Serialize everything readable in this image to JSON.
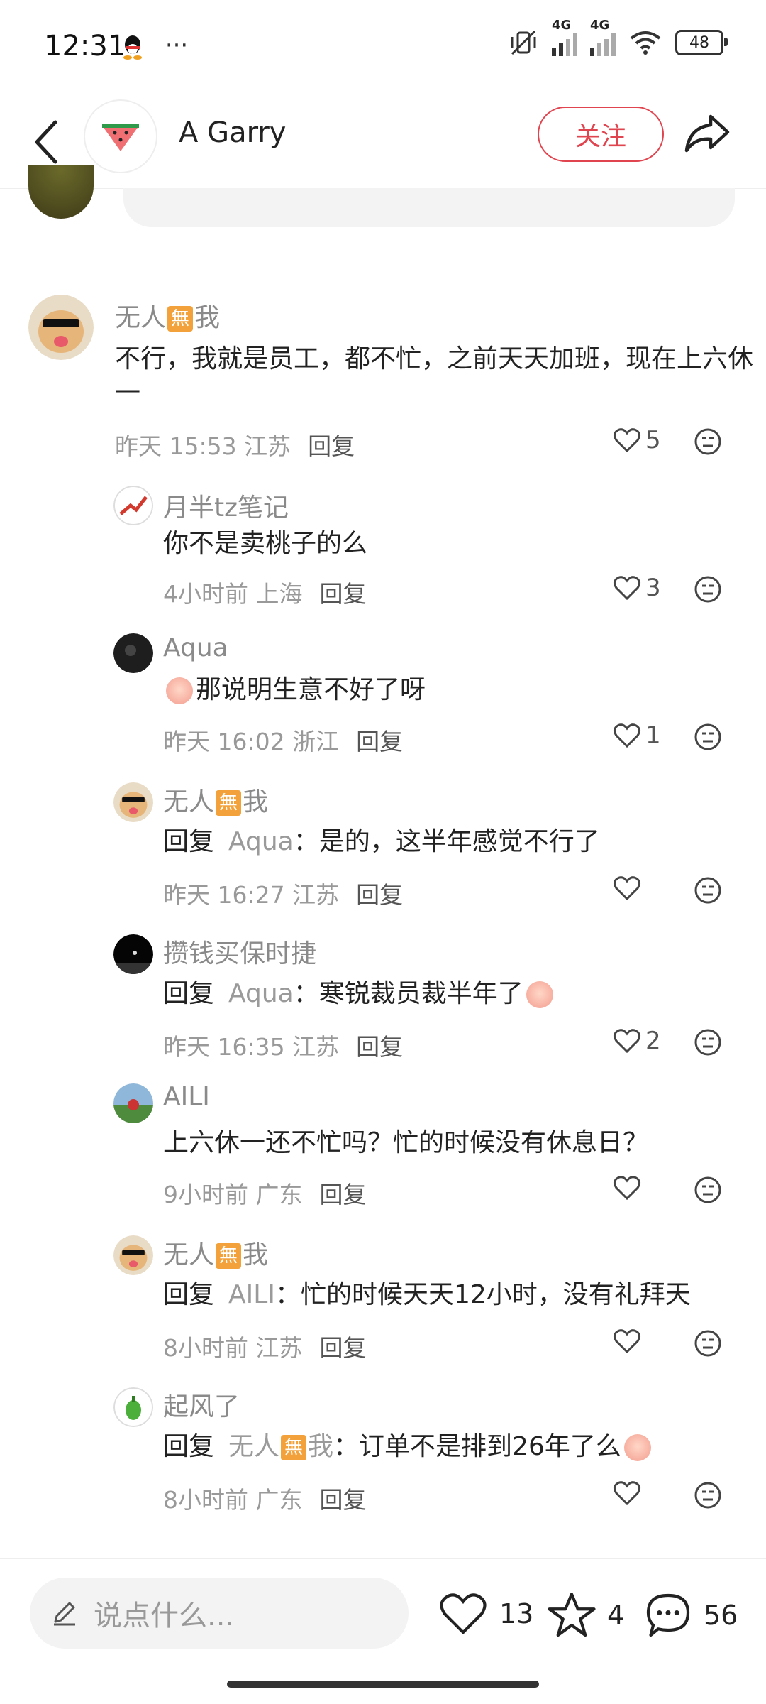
{
  "status_bar": {
    "time": "12:31",
    "more": "···",
    "net1": "4G",
    "net2": "4G",
    "battery": "48"
  },
  "header": {
    "title": "A Garry",
    "follow_label": "关注"
  },
  "comments": [
    {
      "name_a": "无人",
      "badge": "無",
      "name_b": "我",
      "text": "不行，我就是员工，都不忙，之前天天加班，现在上六休一",
      "meta": "昨天 15:53 江苏",
      "reply_label": "回复",
      "likes": "5"
    },
    {
      "name": "月半tz笔记",
      "text": "你不是卖桃子的么",
      "meta": "4小时前 上海",
      "reply_label": "回复",
      "likes": "3"
    },
    {
      "name": "Aqua",
      "text": "那说明生意不好了呀",
      "meta": "昨天 16:02 浙江",
      "reply_label": "回复",
      "likes": "1"
    },
    {
      "name_a": "无人",
      "badge": "無",
      "name_b": "我",
      "prefix": "回复",
      "target": "Aqua",
      "text": "：是的，这半年感觉不行了",
      "meta": "昨天 16:27 江苏",
      "reply_label": "回复",
      "likes": ""
    },
    {
      "name": "攒钱买保时捷",
      "prefix": "回复",
      "target": "Aqua",
      "text": "：寒锐裁员裁半年了",
      "meta": "昨天 16:35 江苏",
      "reply_label": "回复",
      "likes": "2"
    },
    {
      "name": "AILI",
      "text": "上六休一还不忙吗？忙的时候没有休息日？",
      "meta": "9小时前 广东",
      "reply_label": "回复",
      "likes": ""
    },
    {
      "name_a": "无人",
      "badge": "無",
      "name_b": "我",
      "prefix": "回复",
      "target": "AILI",
      "text": "：忙的时候天天12小时，没有礼拜天",
      "meta": "8小时前 江苏",
      "reply_label": "回复",
      "likes": ""
    },
    {
      "name": "起风了",
      "prefix": "回复",
      "target_a": "无人",
      "target_badge": "無",
      "target_b": "我",
      "text": "：订单不是排到26年了么",
      "meta": "8小时前 广东",
      "reply_label": "回复",
      "likes": ""
    }
  ],
  "bottom": {
    "placeholder": "说点什么...",
    "like_count": "13",
    "star_count": "4",
    "comment_count": "56"
  },
  "colors": {
    "accent": "#e0454f",
    "badge": "#f3a23b"
  }
}
